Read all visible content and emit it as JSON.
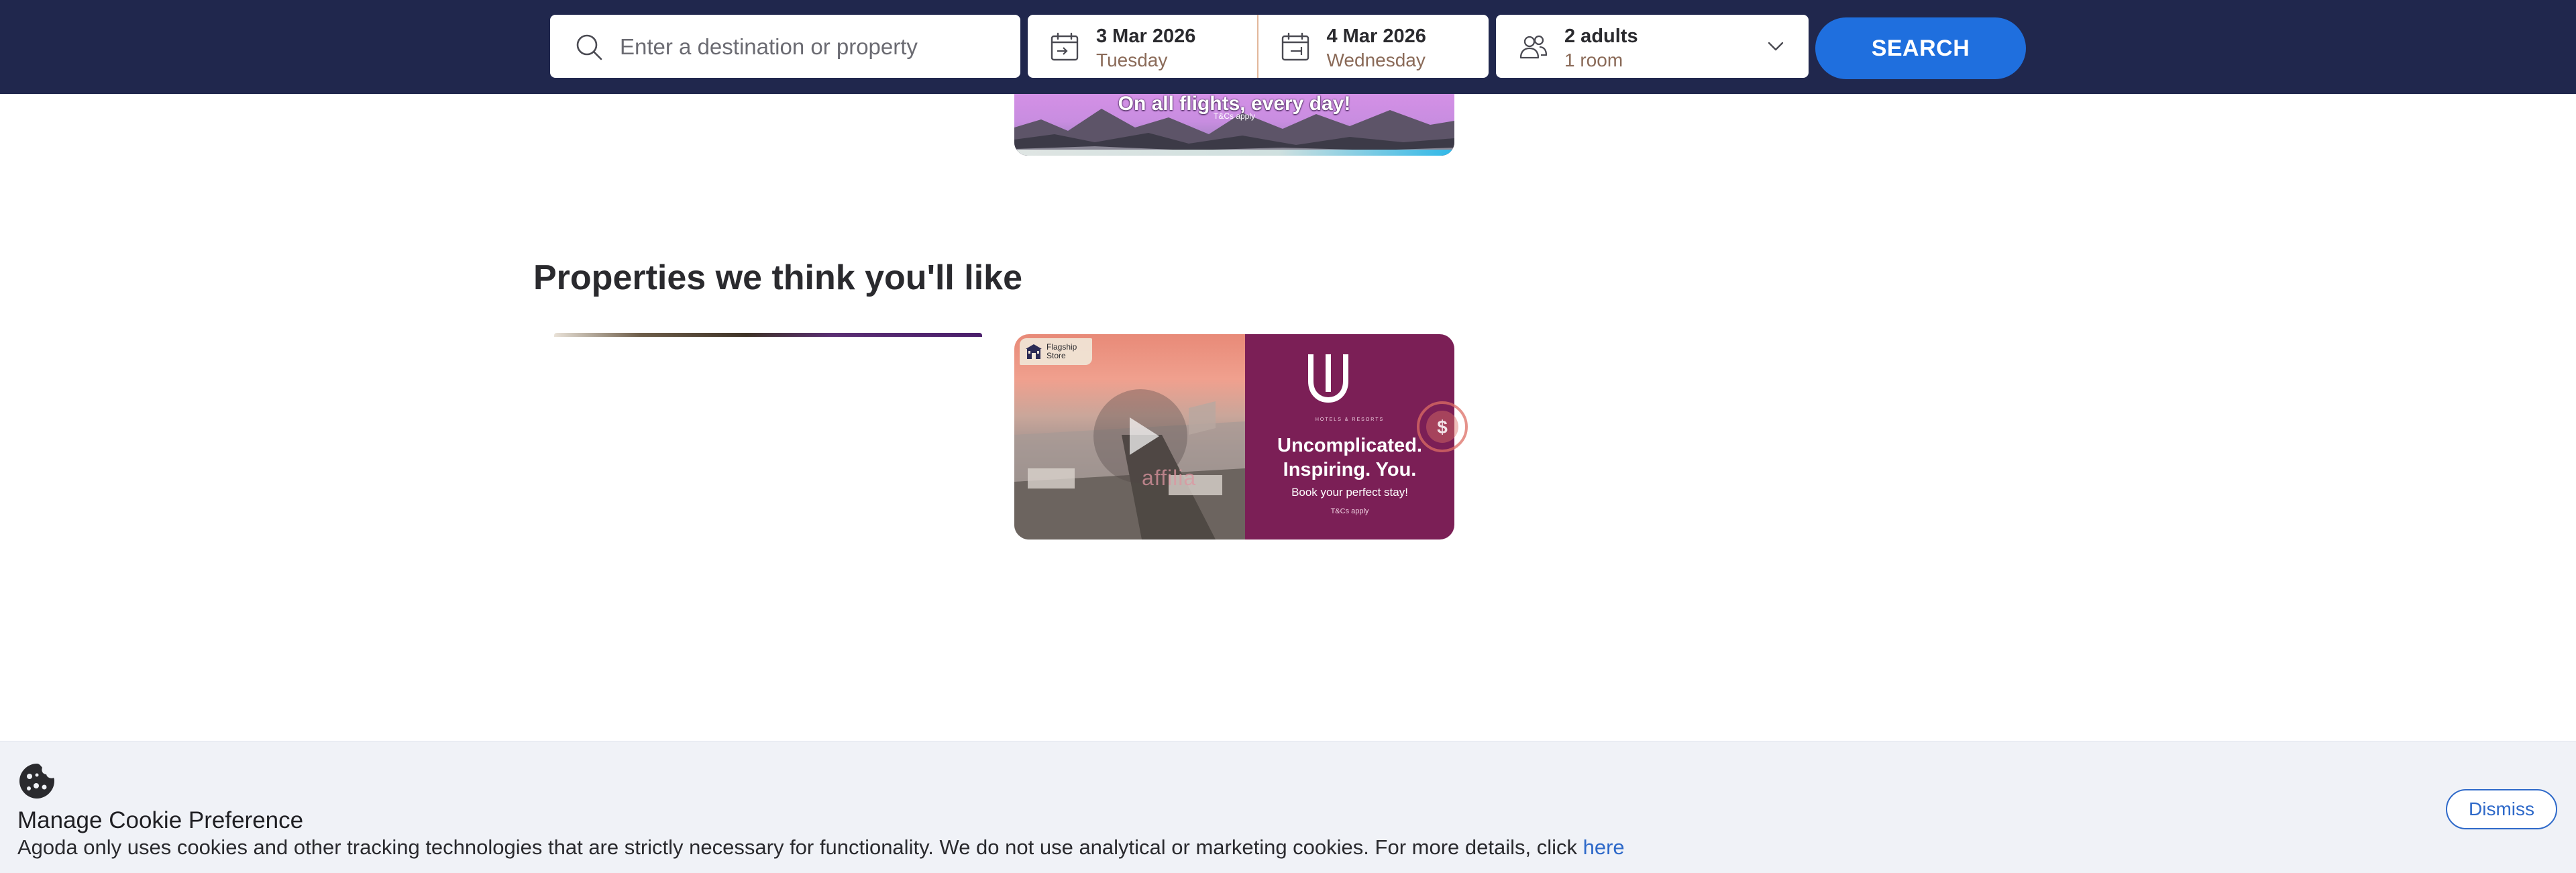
{
  "search": {
    "destination_placeholder": "Enter a destination or property",
    "destination_value": "",
    "checkin": {
      "date": "3 Mar 2026",
      "day": "Tuesday"
    },
    "checkout": {
      "date": "4 Mar 2026",
      "day": "Wednesday"
    },
    "guests": {
      "adults": "2 adults",
      "rooms": "1 room"
    },
    "search_button": "SEARCH"
  },
  "top_banner": {
    "headline": "On all flights, every day!",
    "tcs": "T&Cs apply"
  },
  "section": {
    "title": "Properties we think you'll like"
  },
  "property_card": {
    "badge": "Flagship Store",
    "logo_letter": "U",
    "brand_sub": "HOTELS & RESORTS",
    "headline_line1": "Uncomplicated.",
    "headline_line2": "Inspiring. You.",
    "cta": "Book your perfect stay!",
    "tcs": "T&Cs apply"
  },
  "watermark": {
    "text": "affilia"
  },
  "cookie": {
    "title": "Manage Cookie Preference",
    "text": "Agoda only uses cookies and other tracking technologies that are strictly necessary for functionality. We do not use analytical or marketing cookies. For more details, click ",
    "link": "here",
    "dismiss": "Dismiss"
  },
  "colors": {
    "header_bg": "#20274d",
    "search_button": "#1f6fde",
    "brand_purple": "#7b1f56",
    "link_blue": "#2e69c9",
    "cookie_bg": "#f0f2f7"
  },
  "icons": {
    "destination": "search-icon",
    "checkin": "calendar-checkin-icon",
    "checkout": "calendar-checkout-icon",
    "guests": "people-icon",
    "guests_toggle": "chevron-down-icon",
    "badge": "store-icon",
    "cookie": "cookie-icon"
  }
}
